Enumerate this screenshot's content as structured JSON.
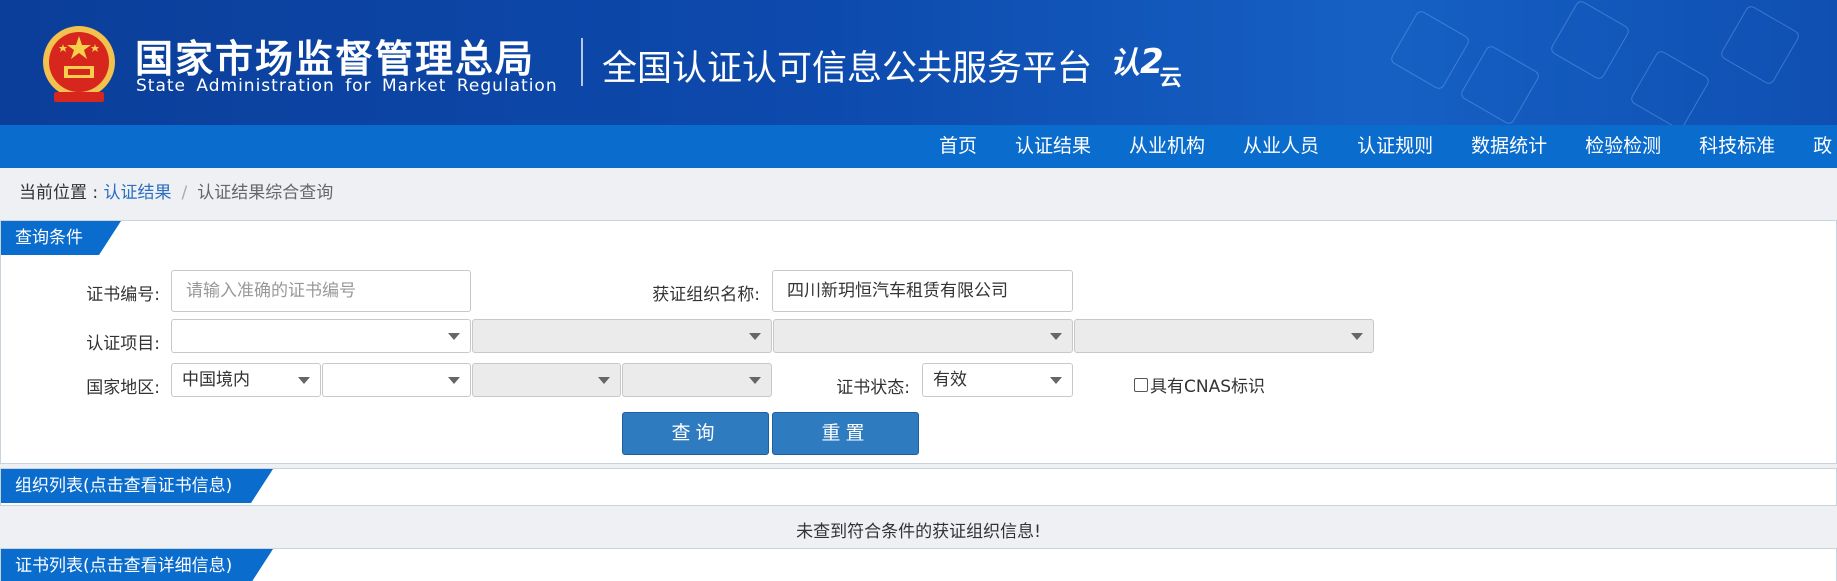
{
  "header": {
    "agency_cn": "国家市场监督管理总局",
    "agency_en": "State Administration  for  Market Regulation",
    "platform_title": "全国认证认可信息公共服务平台",
    "cloud_logo_main": "认",
    "cloud_logo_sub": "云",
    "colors": {
      "banner": "#0d4aad",
      "navbar": "#0a6ccc"
    }
  },
  "nav": {
    "items": [
      {
        "label": "首页"
      },
      {
        "label": "认证结果"
      },
      {
        "label": "从业机构"
      },
      {
        "label": "从业人员"
      },
      {
        "label": "认证规则"
      },
      {
        "label": "数据统计"
      },
      {
        "label": "检验检测"
      },
      {
        "label": "科技标准"
      },
      {
        "label": "政"
      }
    ]
  },
  "breadcrumb": {
    "prefix": "当前位置 : ",
    "link": "认证结果",
    "separator": "/",
    "current": "认证结果综合查询"
  },
  "query_panel": {
    "tab_label": "查询条件",
    "cert_no_label": "证书编号:",
    "cert_no_placeholder": "请输入准确的证书编号",
    "cert_no_value": "",
    "org_name_label": "获证组织名称:",
    "org_name_value": "四川新玥恒汽车租赁有限公司",
    "project_label": "认证项目:",
    "region_label": "国家地区:",
    "region_value": "中国境内",
    "status_label": "证书状态:",
    "status_value": "有效",
    "cnas_label": "具有CNAS标识",
    "cnas_checked": false,
    "search_button": "查询",
    "reset_button": "重置"
  },
  "org_panel": {
    "tab_label": "组织列表(点击查看证书信息)",
    "empty_message": "未查到符合条件的获证组织信息!"
  },
  "cert_panel": {
    "tab_label": "证书列表(点击查看详细信息)"
  }
}
